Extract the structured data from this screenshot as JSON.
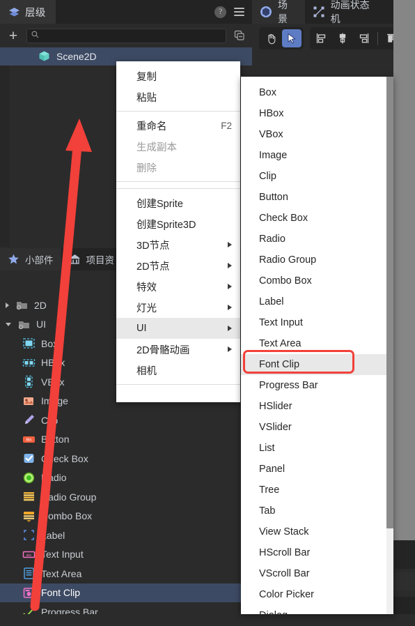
{
  "hierarchy_panel": {
    "tab_label": "层级",
    "tab_icon": "layers-icon",
    "help_icon": "?",
    "menu_icon": "hamburger-icon",
    "add_label": "+",
    "search_placeholder": "",
    "search_value": "",
    "collapse_icon": "collapse-all-icon",
    "tree": [
      {
        "label": "Scene2D",
        "icon": "scene2d-cube-icon",
        "selected": true
      }
    ]
  },
  "widget_panel": {
    "tabs": [
      {
        "label": "小部件",
        "icon": "star-icon",
        "active": true
      },
      {
        "label": "项目资",
        "icon": "home-icon",
        "active": false
      }
    ],
    "items": [
      {
        "label": "2D",
        "icon": "folder-2d-icon",
        "expanded": false,
        "depth": 0,
        "selected": false
      },
      {
        "label": "UI",
        "icon": "folder-ui-icon",
        "expanded": true,
        "depth": 0,
        "selected": false
      },
      {
        "label": "Box",
        "icon": "box-icon",
        "depth": 1,
        "selected": false
      },
      {
        "label": "HBox",
        "icon": "hbox-icon",
        "depth": 1,
        "selected": false
      },
      {
        "label": "VBox",
        "icon": "vbox-icon",
        "depth": 1,
        "selected": false
      },
      {
        "label": "Image",
        "icon": "image-icon",
        "depth": 1,
        "selected": false
      },
      {
        "label": "Clip",
        "icon": "clip-icon",
        "depth": 1,
        "selected": false
      },
      {
        "label": "Button",
        "icon": "button-icon",
        "depth": 1,
        "selected": false
      },
      {
        "label": "Check Box",
        "icon": "checkbox-icon",
        "depth": 1,
        "selected": false
      },
      {
        "label": "Radio",
        "icon": "radio-icon",
        "depth": 1,
        "selected": false
      },
      {
        "label": "Radio Group",
        "icon": "radio-group-icon",
        "depth": 1,
        "selected": false
      },
      {
        "label": "Combo Box",
        "icon": "combobox-icon",
        "depth": 1,
        "selected": false
      },
      {
        "label": "Label",
        "icon": "label-icon",
        "depth": 1,
        "selected": false
      },
      {
        "label": "Text Input",
        "icon": "text-input-icon",
        "depth": 1,
        "selected": false
      },
      {
        "label": "Text Area",
        "icon": "text-area-icon",
        "depth": 1,
        "selected": false
      },
      {
        "label": "Font Clip",
        "icon": "font-clip-icon",
        "depth": 1,
        "selected": true
      },
      {
        "label": "Progress Bar",
        "icon": "progress-bar-icon",
        "depth": 1,
        "selected": false
      }
    ]
  },
  "right_panel": {
    "tabs": [
      {
        "label": "场景",
        "icon": "scene-icon",
        "active": true
      },
      {
        "label": "动画状态机",
        "icon": "anim-state-icon",
        "active": false
      },
      {
        "label": "",
        "icon": "pac-icon",
        "active": false
      }
    ],
    "toolbar": [
      {
        "name": "hand-tool",
        "icon": "hand-icon",
        "active": false
      },
      {
        "name": "select-tool",
        "icon": "cursor-icon",
        "active": true
      },
      {
        "name": "align-left",
        "icon": "align-left-icon",
        "active": false
      },
      {
        "name": "align-center-vertical",
        "icon": "align-center-v-icon",
        "active": false
      },
      {
        "name": "align-right",
        "icon": "align-right-icon",
        "active": false
      },
      {
        "name": "align-top",
        "icon": "align-top-icon",
        "active": false
      }
    ]
  },
  "context_menu": {
    "items": [
      {
        "label": "复制",
        "type": "item"
      },
      {
        "label": "粘贴",
        "type": "item"
      },
      {
        "type": "separator"
      },
      {
        "label": "重命名",
        "shortcut": "F2",
        "type": "item"
      },
      {
        "label": "生成副本",
        "type": "item",
        "disabled": true
      },
      {
        "label": "删除",
        "type": "item",
        "disabled": true
      },
      {
        "type": "separator"
      },
      {
        "type": "separator"
      },
      {
        "label": "创建Sprite",
        "type": "item"
      },
      {
        "label": "创建Sprite3D",
        "type": "item"
      },
      {
        "label": "3D节点",
        "type": "submenu"
      },
      {
        "label": "2D节点",
        "type": "submenu"
      },
      {
        "label": "特效",
        "type": "submenu"
      },
      {
        "label": "灯光",
        "type": "submenu"
      },
      {
        "label": "UI",
        "type": "submenu",
        "highlighted": true
      },
      {
        "label": "2D骨骼动画",
        "type": "submenu"
      },
      {
        "label": "相机",
        "type": "item"
      },
      {
        "type": "separator"
      }
    ]
  },
  "ui_submenu": {
    "items": [
      {
        "label": "Box"
      },
      {
        "label": "HBox"
      },
      {
        "label": "VBox"
      },
      {
        "label": "Image"
      },
      {
        "label": "Clip"
      },
      {
        "label": "Button"
      },
      {
        "label": "Check Box"
      },
      {
        "label": "Radio"
      },
      {
        "label": "Radio Group"
      },
      {
        "label": "Combo Box"
      },
      {
        "label": "Label"
      },
      {
        "label": "Text Input"
      },
      {
        "label": "Text Area"
      },
      {
        "label": "Font Clip",
        "highlighted": true,
        "annotated": true
      },
      {
        "label": "Progress Bar"
      },
      {
        "label": "HSlider"
      },
      {
        "label": "VSlider"
      },
      {
        "label": "List"
      },
      {
        "label": "Panel"
      },
      {
        "label": "Tree"
      },
      {
        "label": "Tab"
      },
      {
        "label": "View Stack"
      },
      {
        "label": "HScroll Bar"
      },
      {
        "label": "VScroll Bar"
      },
      {
        "label": "Color Picker"
      },
      {
        "label": "Dialog"
      }
    ]
  },
  "annotation": {
    "arrow_color": "#f2403a",
    "highlight_color": "#f2403a",
    "arrow_from": "font-clip-widget-item",
    "arrow_to": "scene2d-tree-node"
  }
}
